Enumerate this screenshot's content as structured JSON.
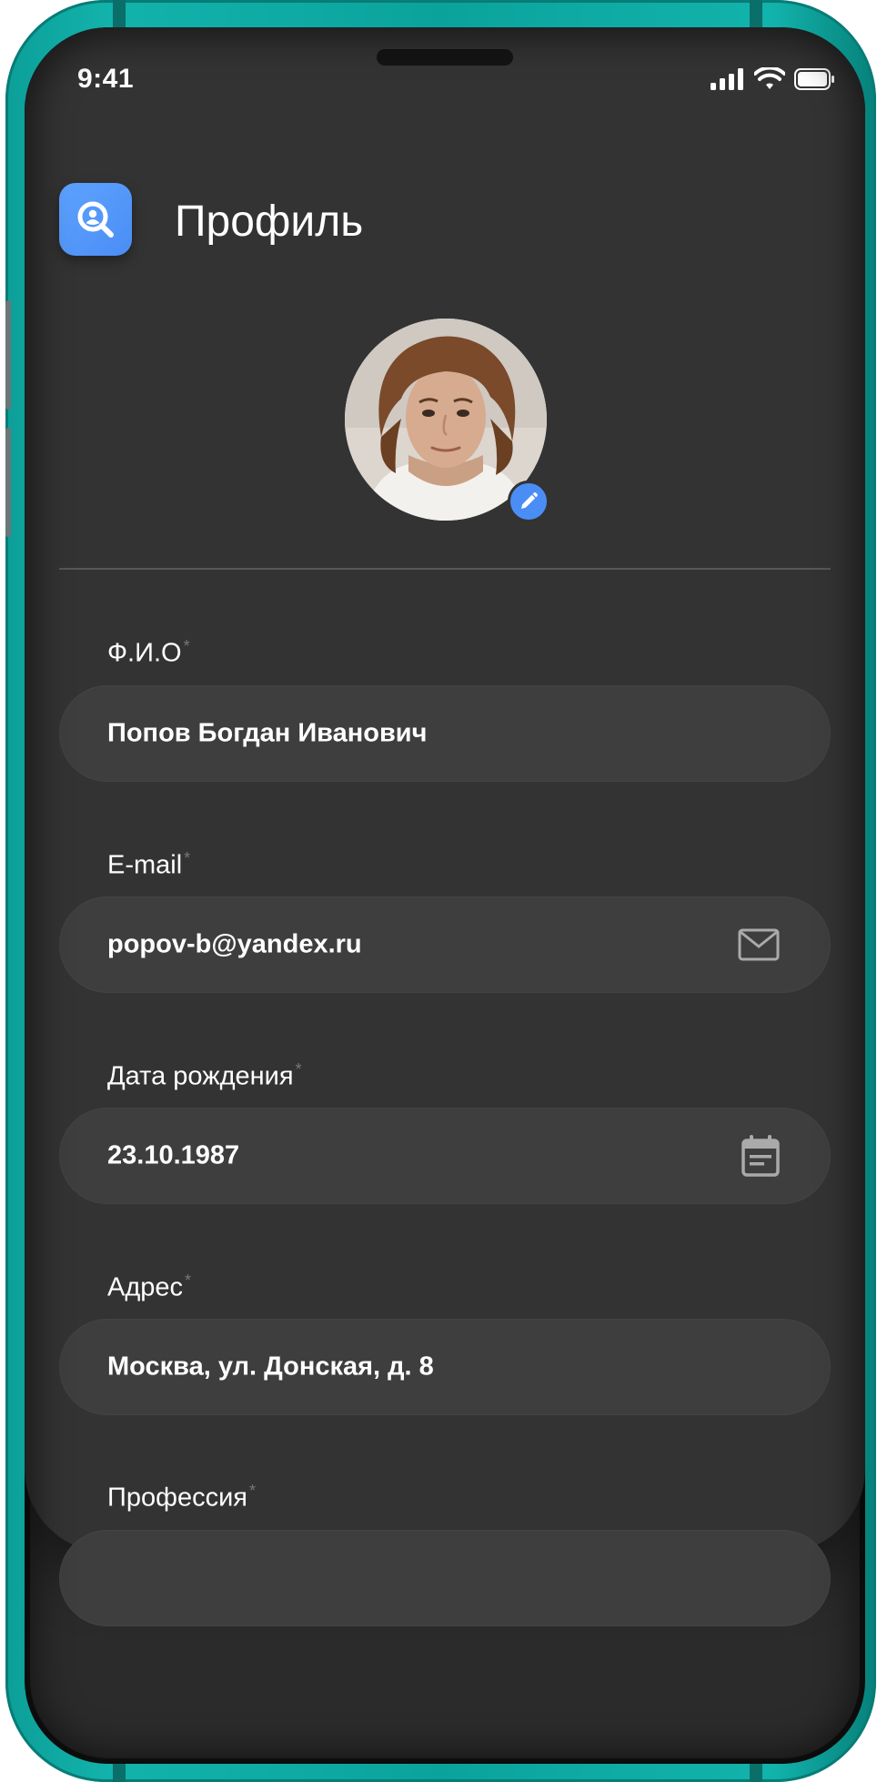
{
  "status_bar": {
    "time": "9:41"
  },
  "header": {
    "title": "Профиль",
    "app_icon": "profile-search-icon"
  },
  "avatar": {
    "edit_icon": "pencil-icon"
  },
  "form": {
    "required_mark": "*",
    "fields": [
      {
        "label": "Ф.И.О",
        "value": "Попов Богдан Иванович",
        "icon": ""
      },
      {
        "label": "E-mail",
        "value": "popov-b@yandex.ru",
        "icon": "mail-icon"
      },
      {
        "label": "Дата рождения",
        "value": "23.10.1987",
        "icon": "calendar-icon"
      },
      {
        "label": "Адрес",
        "value": "Москва, ул. Донская, д. 8",
        "icon": ""
      },
      {
        "label": "Профессия",
        "value": "",
        "icon": ""
      }
    ]
  },
  "colors": {
    "accent": "#4A8EF5",
    "device_frame": "#0AA39C",
    "background": "#333333",
    "field": "#3E3E3E"
  }
}
